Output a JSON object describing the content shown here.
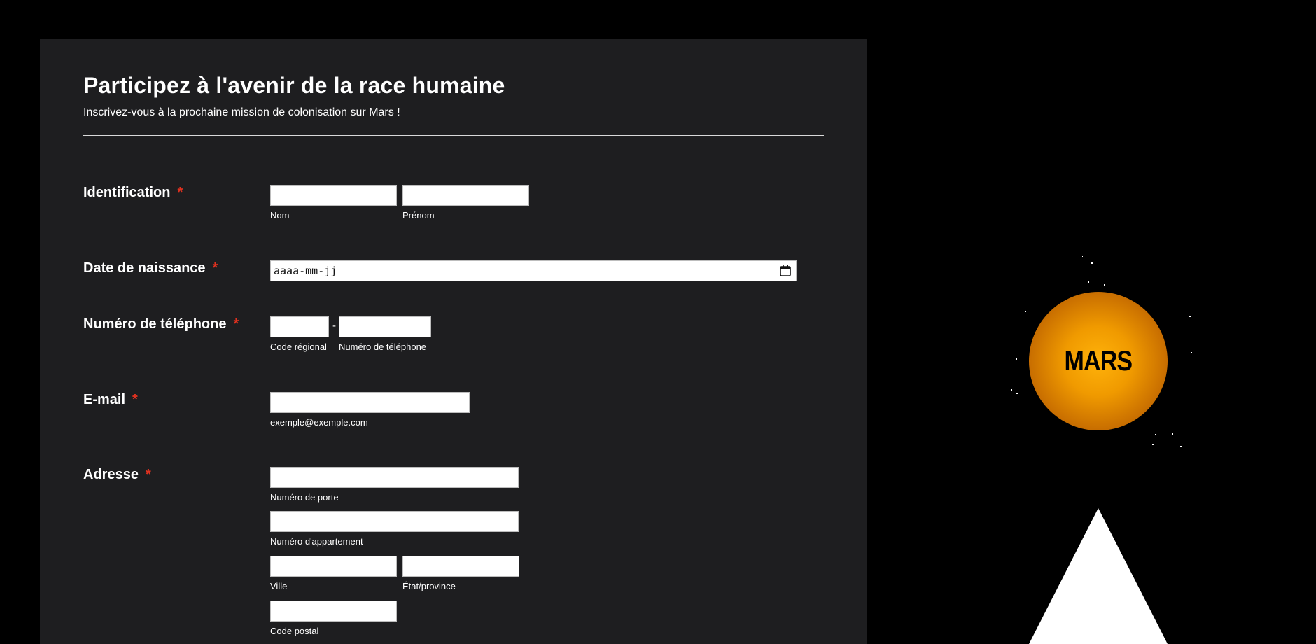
{
  "form": {
    "title": "Participez à l'avenir de la race humaine",
    "subtitle": "Inscrivez-vous à la prochaine mission de colonisation sur Mars !",
    "required_mark": "*",
    "identification": {
      "label": "Identification",
      "nom_label": "Nom",
      "prenom_label": "Prénom",
      "nom_value": "",
      "prenom_value": ""
    },
    "birthdate": {
      "label": "Date de naissance",
      "placeholder": "aaaa-mm-jj"
    },
    "phone": {
      "label": "Numéro de téléphone",
      "separator": "-",
      "area_code_label": "Code régional",
      "number_label": "Numéro de téléphone"
    },
    "email": {
      "label": "E-mail",
      "hint": "exemple@exemple.com"
    },
    "address": {
      "label": "Adresse",
      "street_number_label": "Numéro de porte",
      "apartment_label": "Numéro d'appartement",
      "city_label": "Ville",
      "state_label": "État/province",
      "postal_code_label": "Code postal"
    }
  },
  "scene": {
    "planet_label": "MARS",
    "planet_color": "#f5a000",
    "rocket_color": "#ffffff",
    "background": "#000000",
    "card_background": "#1e1e20",
    "required_color": "#e0311f",
    "icons": [
      "calendar-icon"
    ]
  }
}
